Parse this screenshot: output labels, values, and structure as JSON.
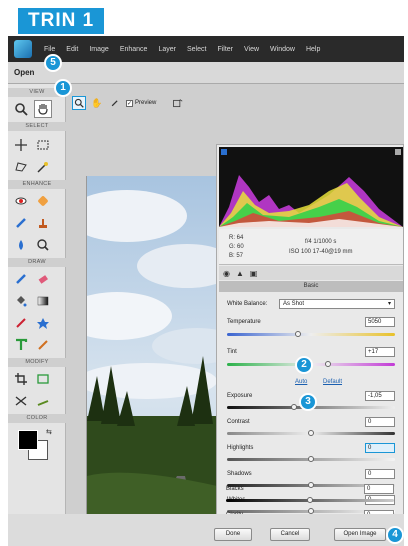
{
  "badge": "TRIN 1",
  "menu": [
    "File",
    "Edit",
    "Image",
    "Enhance",
    "Layer",
    "Select",
    "Filter",
    "View",
    "Window",
    "Help"
  ],
  "dialog_title": "Open",
  "callouts": {
    "c1": "1",
    "c2": "2",
    "c3": "3",
    "c4": "4",
    "c5": "5"
  },
  "toolbox": {
    "sections": [
      "VIEW",
      "SELECT",
      "ENHANCE",
      "DRAW",
      "MODIFY",
      "COLOR"
    ]
  },
  "canvas_toolbar": {
    "preview_label": "Preview",
    "preview_checked": "✓"
  },
  "info": {
    "rgb": [
      "R: 64",
      "G: 60",
      "B: 57"
    ],
    "camera_line1": "f/4  1/1000 s",
    "camera_line2": "ISO 100  17-40@19 mm"
  },
  "panel_title": "Basic",
  "white_balance": {
    "label": "White Balance:",
    "value": "As Shot"
  },
  "sliders": {
    "temperature": {
      "label": "Temperature",
      "value": "5050",
      "level": 0.42
    },
    "tint": {
      "label": "Tint",
      "value": "+17",
      "level": 0.6
    },
    "exposure": {
      "label": "Exposure",
      "value": "-1,05",
      "level": 0.4
    },
    "contrast": {
      "label": "Contrast",
      "value": "0",
      "level": 0.5
    },
    "highlights": {
      "label": "Highlights",
      "value": "0",
      "level": 0.5
    },
    "shadows": {
      "label": "Shadows",
      "value": "0",
      "level": 0.5
    },
    "whites": {
      "label": "Whites",
      "value": "0",
      "level": 0.5
    },
    "blacks": {
      "label": "Blacks",
      "value": "0",
      "level": 0.5
    },
    "clarity": {
      "label": "Clarity",
      "value": "0"
    }
  },
  "auto_link": "Auto",
  "default_link": "Default",
  "buttons": {
    "done": "Done",
    "cancel": "Cancel",
    "open": "Open Image"
  }
}
